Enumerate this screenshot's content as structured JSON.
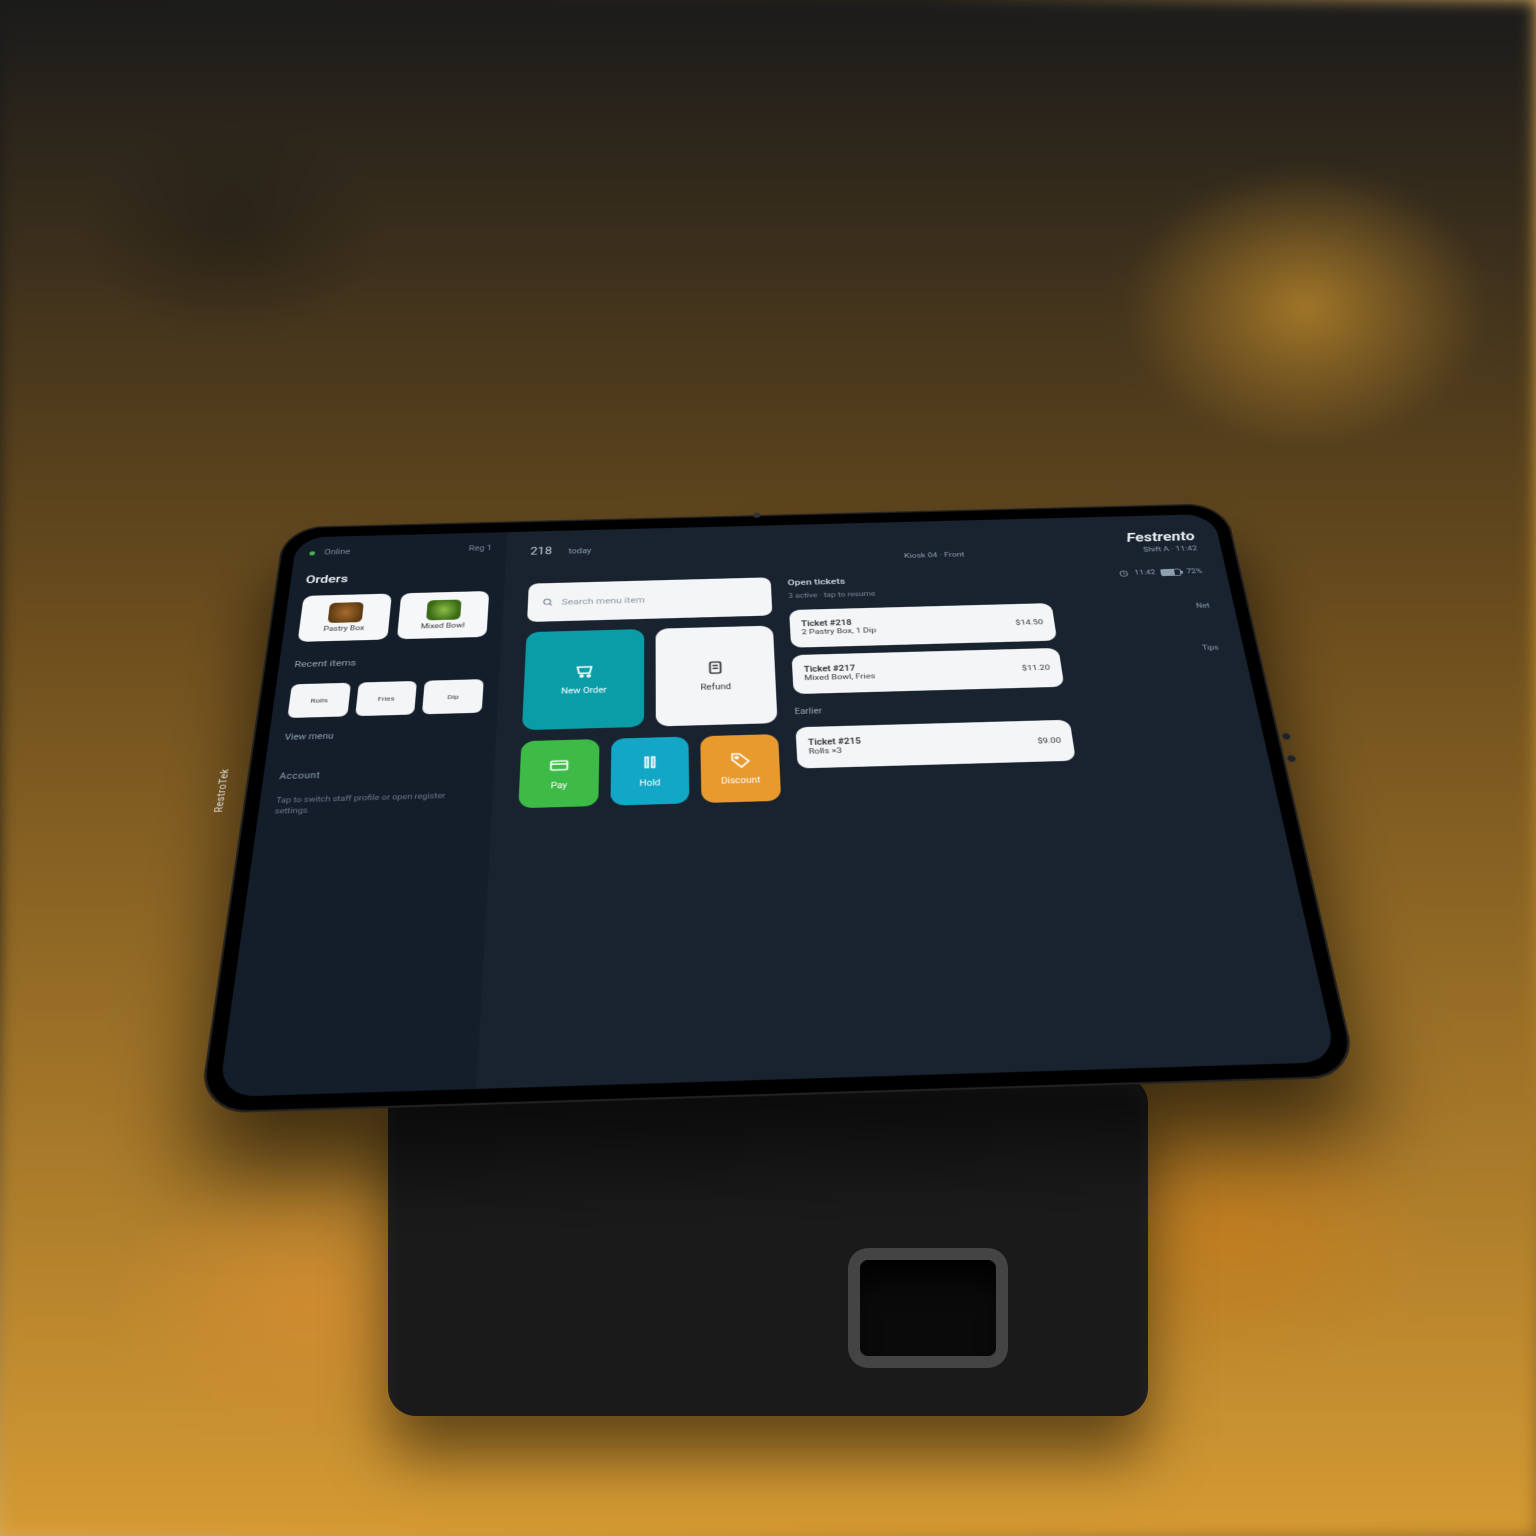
{
  "device": {
    "brand_stamp": "RestroTek"
  },
  "status": {
    "indicator": "Online",
    "register": "Reg 1"
  },
  "sidebar": {
    "title": "Orders",
    "featured": [
      {
        "label": "Pastry Box"
      },
      {
        "label": "Mixed Bowl"
      }
    ],
    "sub": "Recent items",
    "minis": [
      {
        "label": "Rolls"
      },
      {
        "label": "Fries"
      },
      {
        "label": "Dip"
      }
    ],
    "link": "View menu",
    "section_label": "Account",
    "section_desc": "Tap to switch staff profile or open register settings."
  },
  "header": {
    "figure_main": "218",
    "figure_note": "today",
    "brand": "Festrento",
    "store_name": "Kiosk 04 · Front",
    "store_sub": "Shift A · 11:42"
  },
  "left": {
    "input_placeholder": "Search menu item",
    "tiles": [
      {
        "label": "New Order",
        "color": "teal",
        "icon": "cart"
      },
      {
        "label": "Pay",
        "color": "green",
        "icon": "card"
      },
      {
        "label": "Hold",
        "color": "cyan",
        "icon": "pause"
      },
      {
        "label": "Refund",
        "color": "white",
        "icon": "receipt"
      },
      {
        "label": "Discount",
        "color": "orange",
        "icon": "tag"
      }
    ]
  },
  "orders": {
    "panel_title": "Open tickets",
    "panel_sub": "3 active · tap to resume",
    "items": [
      {
        "name": "Ticket #218",
        "detail": "2 Pastry Box, 1 Dip",
        "amount": "$14.50"
      },
      {
        "name": "Ticket #217",
        "detail": "Mixed Bowl, Fries",
        "amount": "$11.20"
      }
    ],
    "divider": "Earlier",
    "more": [
      {
        "name": "Ticket #215",
        "detail": "Rolls ×3",
        "amount": "$9.00"
      }
    ]
  },
  "far": {
    "time": "11:42",
    "battery_label": "72%",
    "stat1": "Net",
    "stat2": "Tips"
  },
  "colors": {
    "bg": "#18232f",
    "sidebar": "#141e2b",
    "teal": "#0b9da7",
    "green": "#3dbb46",
    "cyan": "#12a7c6",
    "orange": "#e89a2d"
  }
}
